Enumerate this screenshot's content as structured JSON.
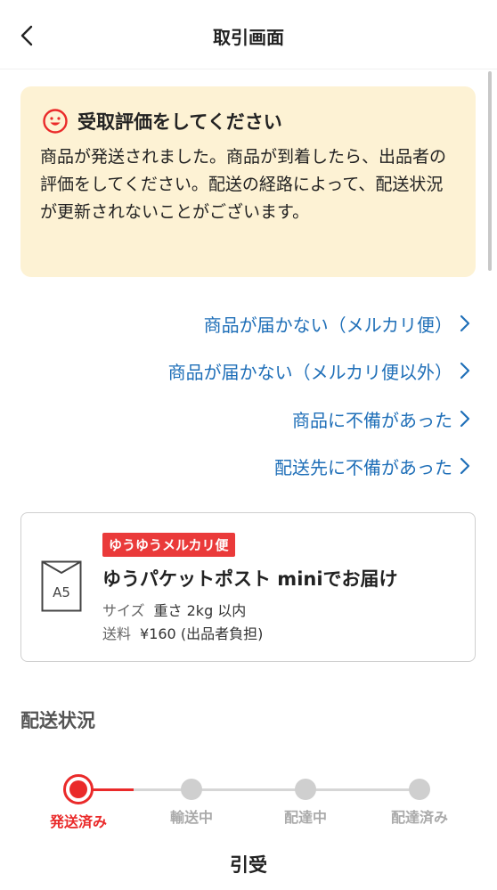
{
  "header": {
    "title": "取引画面"
  },
  "notice": {
    "title": "受取評価をしてください",
    "body": "商品が発送されました。商品が到着したら、出品者の評価をしてください。配送の経路によって、配送状況が更新されないことがございます。"
  },
  "links": [
    {
      "label": "商品が届かない（メルカリ便）"
    },
    {
      "label": "商品が届かない（メルカリ便以外）"
    },
    {
      "label": "商品に不備があった"
    },
    {
      "label": "配送先に不備があった"
    }
  ],
  "shipping": {
    "icon_label": "A5",
    "badge": "ゆうゆうメルカリ便",
    "method": "ゆうパケットポスト miniでお届け",
    "size_label": "サイズ",
    "size_value": "重さ 2kg 以内",
    "fee_label": "送料",
    "fee_value": "¥160 (出品者負担)"
  },
  "delivery_status": {
    "title": "配送状況",
    "steps": [
      {
        "label": "発送済み",
        "active": true
      },
      {
        "label": "輸送中",
        "active": false
      },
      {
        "label": "配達中",
        "active": false
      },
      {
        "label": "配達済み",
        "active": false
      }
    ]
  },
  "next_section": {
    "title": "引受"
  },
  "colors": {
    "accent_red": "#ea2a2a",
    "link_blue": "#1f6fb8",
    "notice_bg": "#fdf2d4",
    "inactive_gray": "#cfcfcf"
  }
}
